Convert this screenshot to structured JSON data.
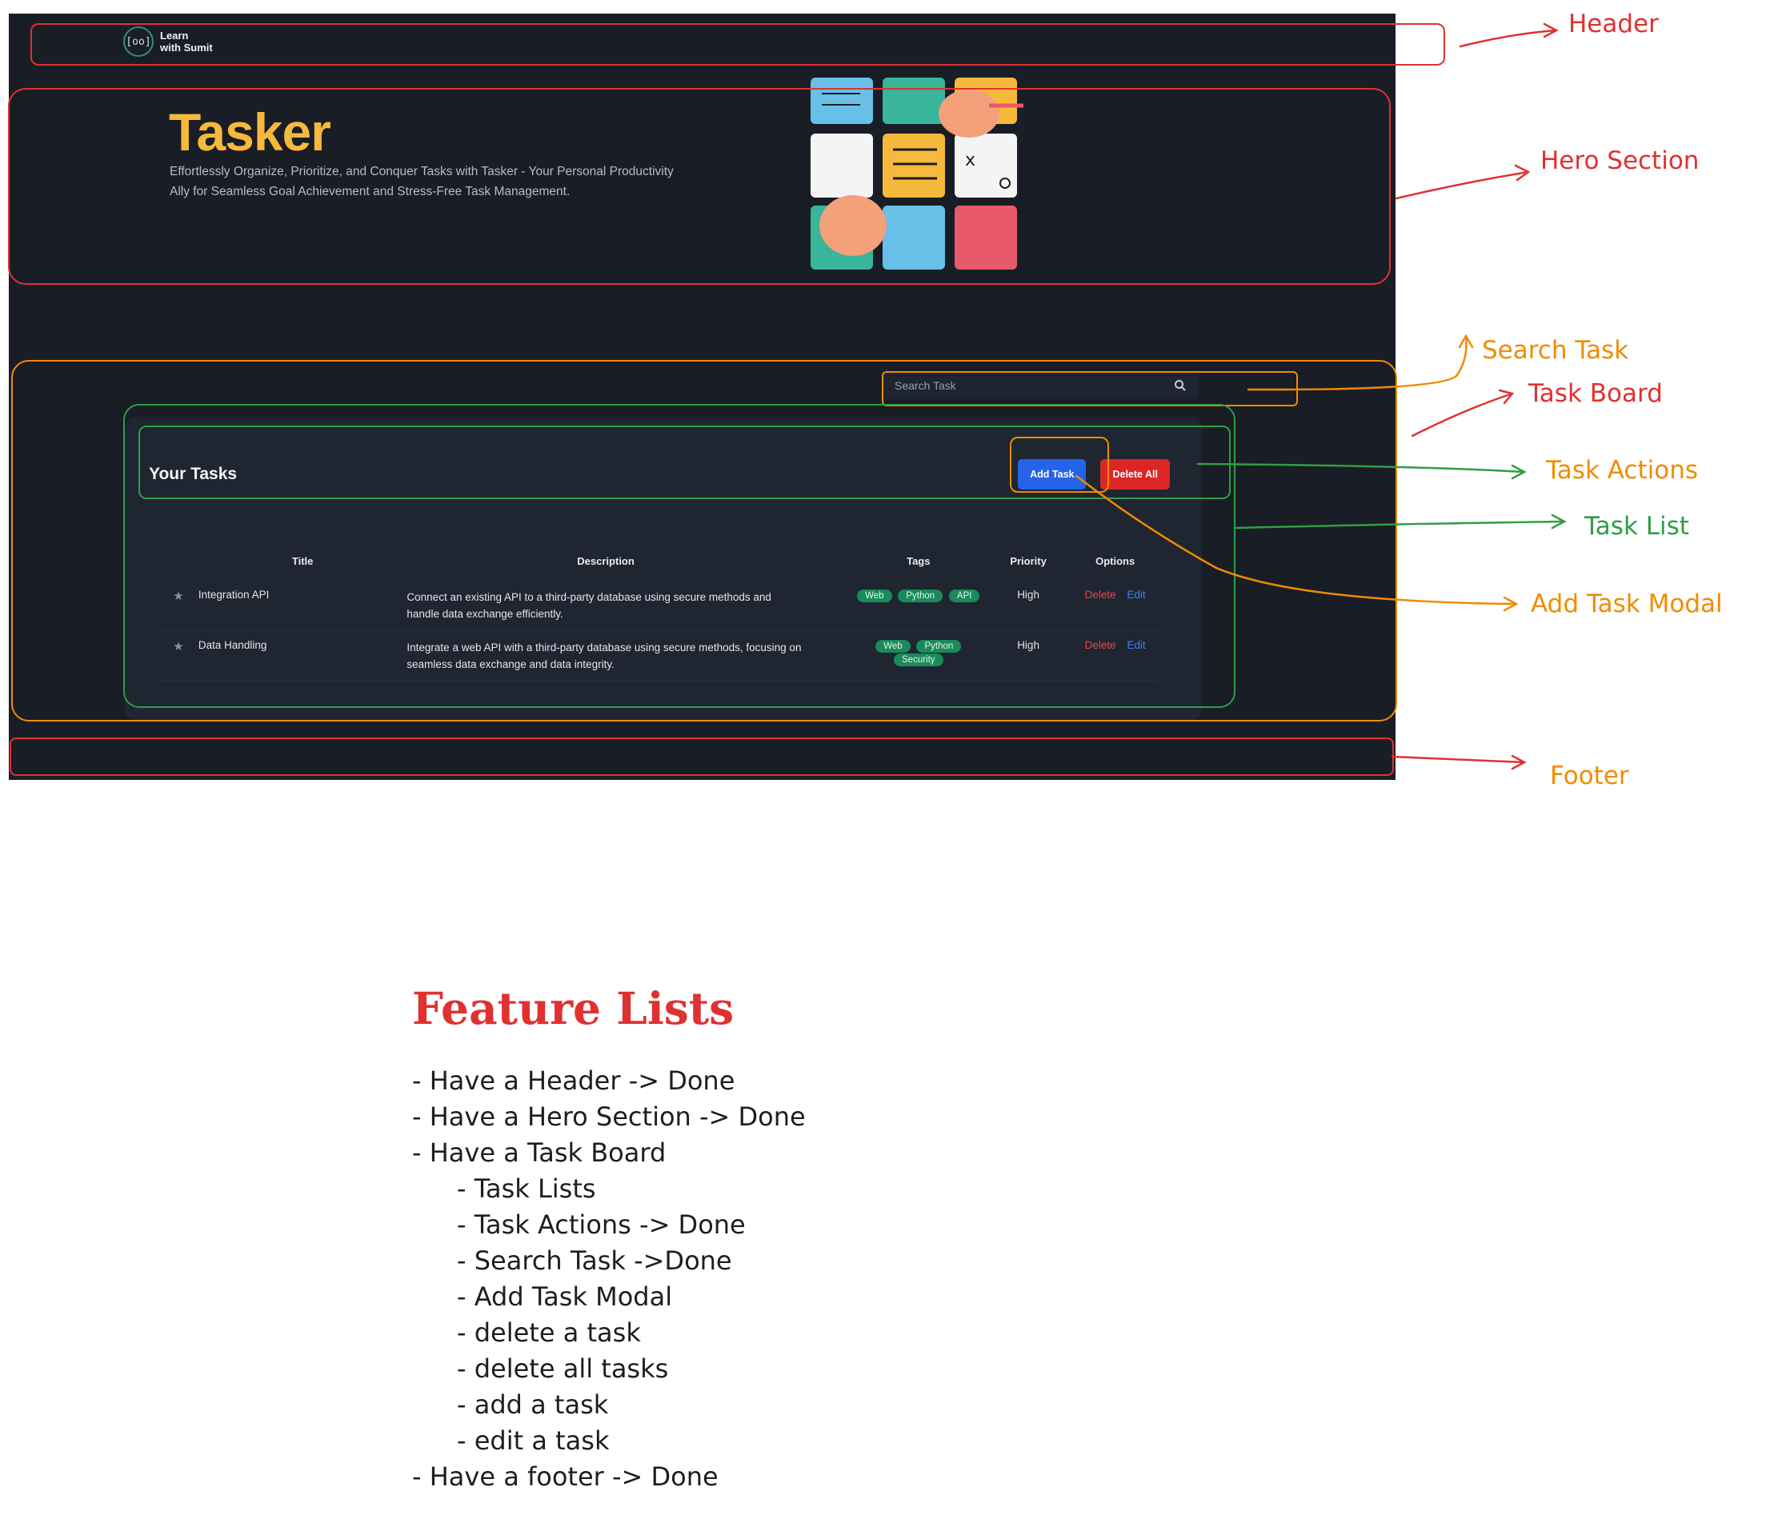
{
  "header": {
    "logo_glyph": "[oo]",
    "logo_line1": "Learn",
    "logo_line2": "with Sumit"
  },
  "hero": {
    "title": "Tasker",
    "description": "Effortlessly Organize, Prioritize, and Conquer Tasks with Tasker - Your Personal Productivity Ally for Seamless Goal Achievement and Stress-Free Task Management."
  },
  "search": {
    "placeholder": "Search Task"
  },
  "board": {
    "title": "Your Tasks",
    "add_label": "Add Task",
    "delete_all_label": "Delete All",
    "columns": [
      "Title",
      "Description",
      "Tags",
      "Priority",
      "Options"
    ],
    "tasks": [
      {
        "title": "Integration API",
        "description": "Connect an existing API to a third-party database using secure methods and handle data exchange efficiently.",
        "tags": [
          "Web",
          "Python",
          "API"
        ],
        "priority": "High",
        "delete_label": "Delete",
        "edit_label": "Edit"
      },
      {
        "title": "Data Handling",
        "description": "Integrate a web API with a third-party database using secure methods, focusing on seamless data exchange and data integrity.",
        "tags": [
          "Web",
          "Python",
          "Security"
        ],
        "priority": "High",
        "delete_label": "Delete",
        "edit_label": "Edit"
      }
    ]
  },
  "annotations": {
    "header": "Header",
    "hero": "Hero Section",
    "search": "Search Task",
    "board": "Task Board",
    "actions": "Task Actions",
    "list": "Task List",
    "modal": "Add Task Modal",
    "footer": "Footer"
  },
  "features": {
    "title": "Feature Lists",
    "items": [
      "- Have a Header -> Done",
      "- Have a Hero Section -> Done",
      "- Have a Task Board",
      "- Task Lists",
      "- Task Actions -> Done",
      "- Search Task ->Done",
      "- Add Task Modal",
      "-  delete a task",
      "- delete all tasks",
      "- add a task",
      "- edit a task",
      "- Have a footer -> Done"
    ]
  },
  "colors": {
    "background": "#191d26",
    "accent": "#f6b93b",
    "add_button": "#2563eb",
    "delete_button": "#dc2626",
    "tag": "#1b8a5a",
    "annotation_red": "#e03131",
    "annotation_orange": "#f08c00",
    "annotation_green": "#2f9e44"
  }
}
